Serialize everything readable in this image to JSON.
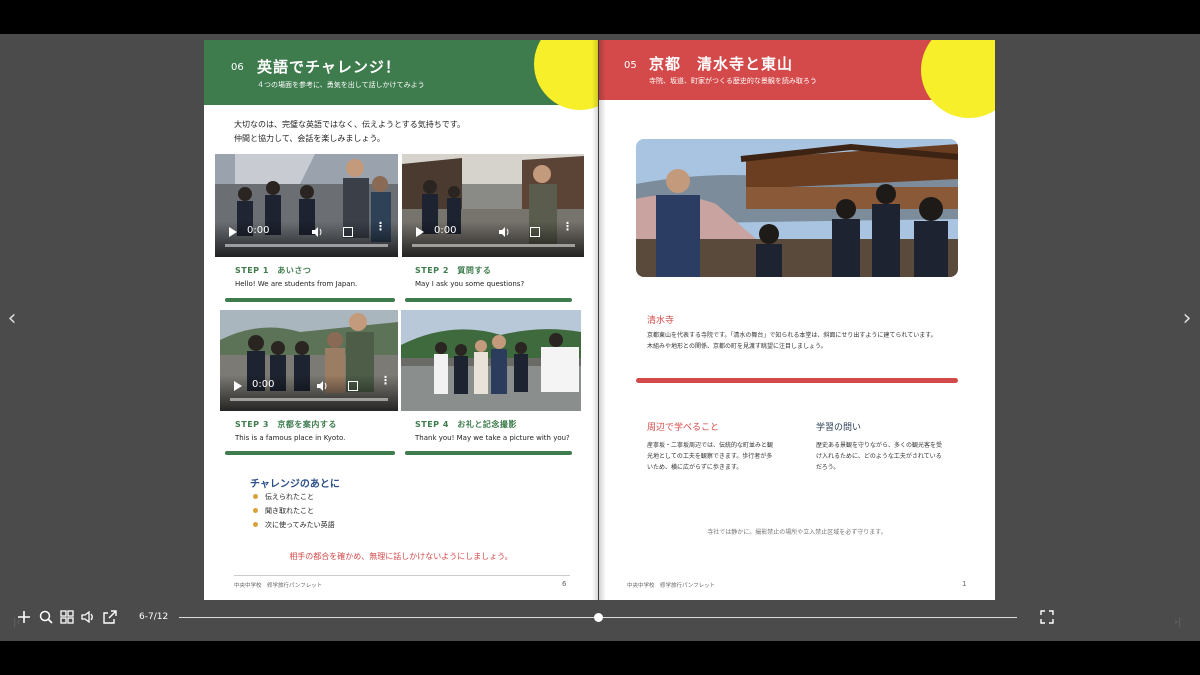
{
  "viewer": {
    "prev_arrow": "‹",
    "next_arrow": "›",
    "first_btn": "|‹",
    "last_btn": "›|",
    "page_counter": "6-7/12",
    "progress_fraction": 0.5
  },
  "toolbar": {
    "icons": [
      "plus-icon",
      "search-icon",
      "grid-icon",
      "speaker-icon",
      "share-icon",
      "fullscreen-icon"
    ]
  },
  "left_page": {
    "section_number": "06",
    "title": "英語でチャレンジ！",
    "subtitle": "４つの場面を参考に、勇気を出して話しかけてみよう",
    "intro_line1": "大切なのは、完璧な英語ではなく、伝えようとする気持ちです。",
    "intro_line2": "仲間と協力して、会話を楽しみましょう。",
    "steps": [
      {
        "label": "STEP 1　あいさつ",
        "text": "Hello! We are students from Japan.",
        "time": "0:00"
      },
      {
        "label": "STEP 2　質問する",
        "text": "May I ask you some questions?",
        "time": "0:00"
      },
      {
        "label": "STEP 3　京都を案内する",
        "text": "This is a famous place in Kyoto.",
        "time": "0:00"
      },
      {
        "label": "STEP 4　お礼と記念撮影",
        "text": "Thank you! May we take a picture with you?"
      }
    ],
    "after_title": "チャレンジのあとに",
    "after_items": [
      "伝えられたこと",
      "聞き取れたこと",
      "次に使ってみたい英語"
    ],
    "warning": "相手の都合を確かめ、無理に話しかけないようにしましょう。",
    "footer_text": "中央中学校　修学旅行パンフレット",
    "page_number": "6"
  },
  "right_page": {
    "section_number": "05",
    "title": "京都　清水寺と東山",
    "subtitle": "寺院、坂道、町家がつくる歴史的な景観を読み取ろう",
    "temple_title": "清水寺",
    "temple_text1": "京都東山を代表する寺院です。「清水の舞台」で知られる本堂は、斜面にせり出すように建てられています。",
    "temple_text2": "木組みや地形との関係、京都の町を見渡す眺望に注目しましょう。",
    "learn_title": "周辺で学べること",
    "learn_text1": "産寧坂・二寧坂周辺では、伝統的な町並みと観",
    "learn_text2": "光地としての工夫を観察できます。歩行者が多",
    "learn_text3": "いため、横に広がらずに歩きます。",
    "question_title": "学習の問い",
    "question_text1": "歴史ある景観を守りながら、多くの観光客を受",
    "question_text2": "け入れるために、どのような工夫がされている",
    "question_text3": "だろう。",
    "note": "寺社では静かに。撮影禁止の場所や立入禁止区域を必ず守ります。",
    "footer_text": "中央中学校　修学旅行パンフレット",
    "page_number": "1"
  },
  "colors": {
    "green": "#3e7b4d",
    "red": "#d44a4a",
    "yellow": "#f6ef2a",
    "navy": "#2d4f8a"
  }
}
